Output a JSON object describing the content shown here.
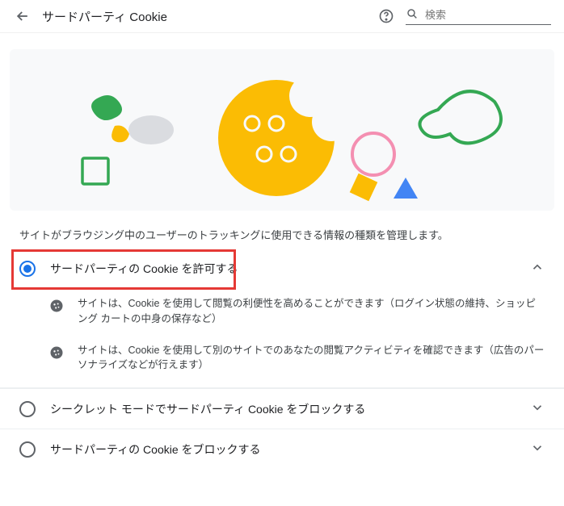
{
  "header": {
    "title": "サードパーティ Cookie",
    "search_placeholder": "検索"
  },
  "description": "サイトがブラウジング中のユーザーのトラッキングに使用できる情報の種類を管理します。",
  "options": [
    {
      "label": "サードパーティの Cookie を許可する",
      "selected": true,
      "expanded": true,
      "details": [
        "サイトは、Cookie を使用して閲覧の利便性を高めることができます（ログイン状態の維持、ショッピング カートの中身の保存など）",
        "サイトは、Cookie を使用して別のサイトでのあなたの閲覧アクティビティを確認できます（広告のパーソナライズなどが行えます）"
      ]
    },
    {
      "label": "シークレット モードでサードパーティ Cookie をブロックする",
      "selected": false,
      "expanded": false
    },
    {
      "label": "サードパーティの Cookie をブロックする",
      "selected": false,
      "expanded": false
    }
  ]
}
